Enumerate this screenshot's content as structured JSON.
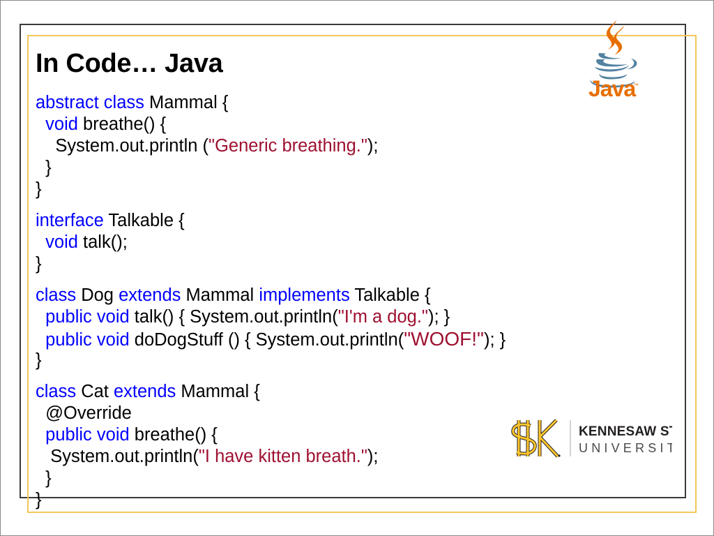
{
  "slide": {
    "title": "In Code… Java",
    "colors": {
      "keyword": "#0000ff",
      "string": "#9e1030",
      "text": "#000000",
      "frame_gold": "#f2c75c",
      "frame_dark": "#3a3a3a",
      "java_orange": "#e76f00",
      "java_blue": "#5382a1",
      "ksu_gold": "#ffc72c",
      "ksu_black": "#231f20"
    }
  },
  "code": {
    "language": "java",
    "lines": [
      {
        "id": "l01",
        "segments": [
          {
            "text": "abstract class",
            "style": "kw"
          },
          {
            "text": " Mammal {",
            "style": "plain"
          }
        ]
      },
      {
        "id": "l02",
        "segments": [
          {
            "text": "  ",
            "style": "plain"
          },
          {
            "text": "void",
            "style": "kw"
          },
          {
            "text": " breathe() {",
            "style": "plain"
          }
        ]
      },
      {
        "id": "l03",
        "segments": [
          {
            "text": "    System.out.println (",
            "style": "plain"
          },
          {
            "text": "\"Generic breathing.\"",
            "style": "str"
          },
          {
            "text": ");",
            "style": "plain"
          }
        ]
      },
      {
        "id": "l04",
        "segments": [
          {
            "text": "  }",
            "style": "plain"
          }
        ]
      },
      {
        "id": "l05",
        "segments": [
          {
            "text": "}",
            "style": "plain"
          }
        ]
      },
      {
        "id": "l06",
        "segments": [
          {
            "text": "",
            "style": "plain"
          }
        ]
      },
      {
        "id": "l07",
        "segments": [
          {
            "text": "interface",
            "style": "kw"
          },
          {
            "text": " Talkable {",
            "style": "plain"
          }
        ]
      },
      {
        "id": "l08",
        "segments": [
          {
            "text": "  ",
            "style": "plain"
          },
          {
            "text": "void",
            "style": "kw"
          },
          {
            "text": " talk();",
            "style": "plain"
          }
        ]
      },
      {
        "id": "l09",
        "segments": [
          {
            "text": "}",
            "style": "plain"
          }
        ]
      },
      {
        "id": "l10",
        "segments": [
          {
            "text": "",
            "style": "plain"
          }
        ]
      },
      {
        "id": "l11",
        "segments": [
          {
            "text": "class",
            "style": "kw"
          },
          {
            "text": " Dog ",
            "style": "plain"
          },
          {
            "text": "extends",
            "style": "kw"
          },
          {
            "text": " Mammal ",
            "style": "plain"
          },
          {
            "text": "implements",
            "style": "kw"
          },
          {
            "text": " Talkable {",
            "style": "plain"
          }
        ]
      },
      {
        "id": "l12",
        "segments": [
          {
            "text": "  ",
            "style": "plain"
          },
          {
            "text": "public void",
            "style": "kw"
          },
          {
            "text": " talk() { System.out.println(",
            "style": "plain"
          },
          {
            "text": "\"I'm a dog.\"",
            "style": "str"
          },
          {
            "text": "); }",
            "style": "plain"
          }
        ]
      },
      {
        "id": "l13",
        "segments": [
          {
            "text": "  ",
            "style": "plain"
          },
          {
            "text": "public void",
            "style": "kw"
          },
          {
            "text": " doDogStuff () { System.out.println(",
            "style": "plain"
          },
          {
            "text": "\"WOOF!\"",
            "style": "str-big"
          },
          {
            "text": "); }",
            "style": "plain"
          }
        ]
      },
      {
        "id": "l14",
        "segments": [
          {
            "text": "}",
            "style": "plain"
          }
        ]
      },
      {
        "id": "l15",
        "segments": [
          {
            "text": "",
            "style": "plain"
          }
        ]
      },
      {
        "id": "l16",
        "segments": [
          {
            "text": "class",
            "style": "kw"
          },
          {
            "text": " Cat ",
            "style": "plain"
          },
          {
            "text": "extends",
            "style": "kw"
          },
          {
            "text": " Mammal {",
            "style": "plain"
          }
        ]
      },
      {
        "id": "l17",
        "segments": [
          {
            "text": "  @Override",
            "style": "plain"
          }
        ]
      },
      {
        "id": "l18",
        "segments": [
          {
            "text": "  ",
            "style": "plain"
          },
          {
            "text": "public void",
            "style": "kw"
          },
          {
            "text": " breathe() {",
            "style": "plain"
          }
        ]
      },
      {
        "id": "l19",
        "segments": [
          {
            "text": "   System.out.println(",
            "style": "plain"
          },
          {
            "text": "\"I have kitten breath.\"",
            "style": "str"
          },
          {
            "text": ");",
            "style": "plain"
          }
        ]
      },
      {
        "id": "l20",
        "segments": [
          {
            "text": "  }",
            "style": "plain"
          }
        ]
      },
      {
        "id": "l21",
        "segments": [
          {
            "text": "}",
            "style": "plain"
          }
        ]
      }
    ]
  },
  "java_logo": {
    "wordmark": "Java",
    "trademark": "™"
  },
  "ksu_logo": {
    "monogram": "KS",
    "line1": "KENNESAW STATE",
    "line2": "UNIVERSITY"
  }
}
